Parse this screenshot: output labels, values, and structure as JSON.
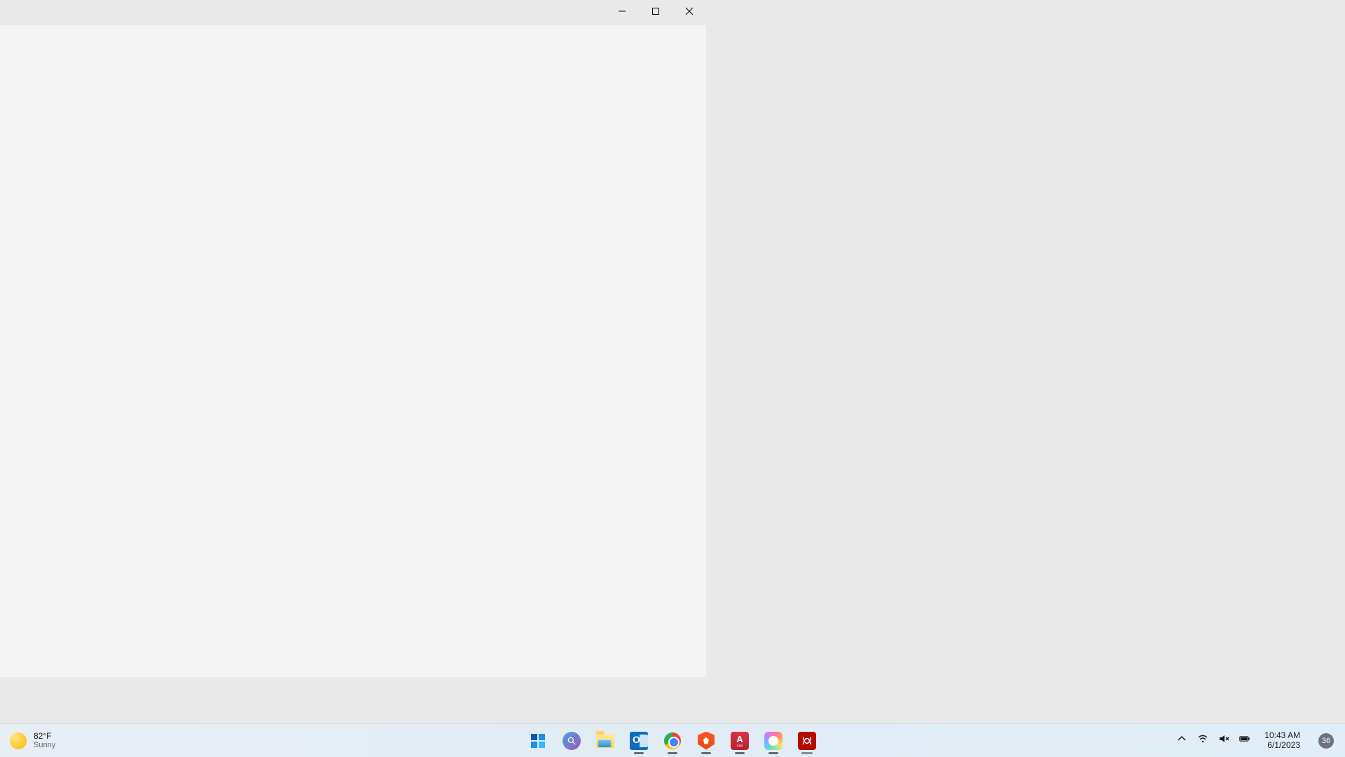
{
  "window": {
    "controls": {
      "minimize": "minimize",
      "maximize": "maximize",
      "close": "close"
    }
  },
  "taskbar": {
    "weather": {
      "temp": "82°F",
      "condition": "Sunny",
      "icon": "sun"
    },
    "apps": [
      {
        "name": "start",
        "label": "Start",
        "active": false
      },
      {
        "name": "search",
        "label": "Search",
        "active": false
      },
      {
        "name": "file-explorer",
        "label": "File Explorer",
        "active": false
      },
      {
        "name": "outlook",
        "label": "Outlook",
        "active": true
      },
      {
        "name": "chrome",
        "label": "Google Chrome",
        "active": true
      },
      {
        "name": "brave",
        "label": "Brave",
        "active": true
      },
      {
        "name": "autocad",
        "label": "AutoCAD",
        "letter": "A",
        "sub": "CAD",
        "active": true
      },
      {
        "name": "creative",
        "label": "Creative App",
        "active": true
      },
      {
        "name": "acrobat",
        "label": "Adobe Acrobat",
        "active": true,
        "focused": true
      }
    ],
    "tray": {
      "chevron": "show-hidden-icons",
      "wifi": "wifi-connected",
      "volume": "volume-muted",
      "battery": "battery-charging"
    },
    "clock": {
      "time": "10:43 AM",
      "date": "6/1/2023"
    },
    "notifications": {
      "count": "36"
    }
  }
}
